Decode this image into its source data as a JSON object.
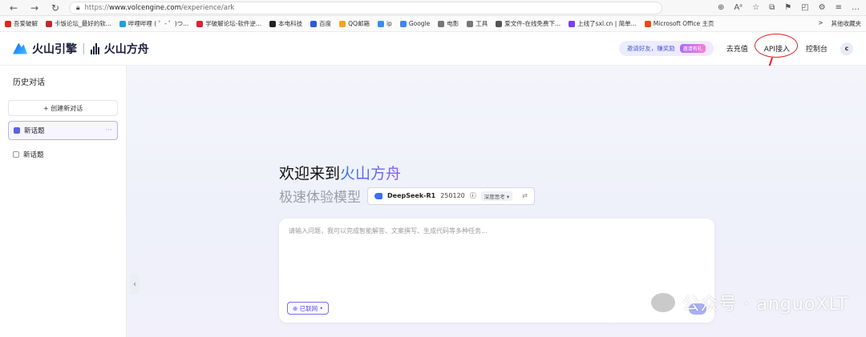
{
  "browser": {
    "url_prefix": "https://",
    "url_host": "www.volcengine.com",
    "url_path": "/experience/ark",
    "nav": [
      "←",
      "→",
      "↻"
    ],
    "right_icons": [
      "⊕",
      "Aᵃ",
      "☆",
      "⧉",
      "⚑",
      "◰",
      "⚙",
      "≡",
      "…"
    ]
  },
  "bookmarks": {
    "items": [
      {
        "label": "吾爱破解",
        "color": "#e2261d"
      },
      {
        "label": "卡饭论坛_最好的软...",
        "color": "#c0282e"
      },
      {
        "label": "哔哩哔哩 ( ゜- ゜)つ...",
        "color": "#1fa0e0"
      },
      {
        "label": "学破解论坛-软件逆...",
        "color": "#d23"
      },
      {
        "label": "本电科技",
        "color": "#222"
      },
      {
        "label": "百度",
        "color": "#2d5bd8"
      },
      {
        "label": "QQ邮箱",
        "color": "#f1a51a"
      },
      {
        "label": "ip",
        "color": "#3a8ee6"
      },
      {
        "label": "Google",
        "color": "#4285f4"
      },
      {
        "label": "电影",
        "color": "#777"
      },
      {
        "label": "工具",
        "color": "#777"
      },
      {
        "label": "爱文件-在线免费下...",
        "color": "#555"
      },
      {
        "label": "上线了sxl.cn | 简单...",
        "color": "#7b3ff2"
      },
      {
        "label": "Microsoft Office 主页",
        "color": "#e64a19"
      }
    ],
    "overflow": ">",
    "other_folder": "其他收藏夹"
  },
  "header": {
    "logo_main": "火山引擎",
    "logo_sub": "火山方舟",
    "invite_text": "邀请好友，赚奖励",
    "invite_tag": "邀请有礼",
    "recharge": "去充值",
    "api": "API接入",
    "console": "控制台",
    "avatar": "c"
  },
  "sidebar": {
    "title": "历史对话",
    "new_chat": "+ 创建新对话",
    "topics": [
      {
        "label": "新话题",
        "active": true,
        "more": "···"
      },
      {
        "label": "新话题",
        "active": false,
        "more": ""
      }
    ]
  },
  "main": {
    "welcome_prefix": "欢迎来到",
    "welcome_brand": "火山方舟",
    "subtitle": "极速体验模型",
    "model": {
      "name": "DeepSeek-R1",
      "version": "250120",
      "info": "ⓘ",
      "mode": "深度思考",
      "mode_arrow": "▾",
      "swap": "⇄"
    },
    "input_placeholder": "请输入问题，我可以完成智能解答、文案撰写、生成代码等多种任务...",
    "web_toggle": "⊕ 已联网 •",
    "collapse": "‹"
  },
  "watermark": "公众号 · anguoXLT"
}
